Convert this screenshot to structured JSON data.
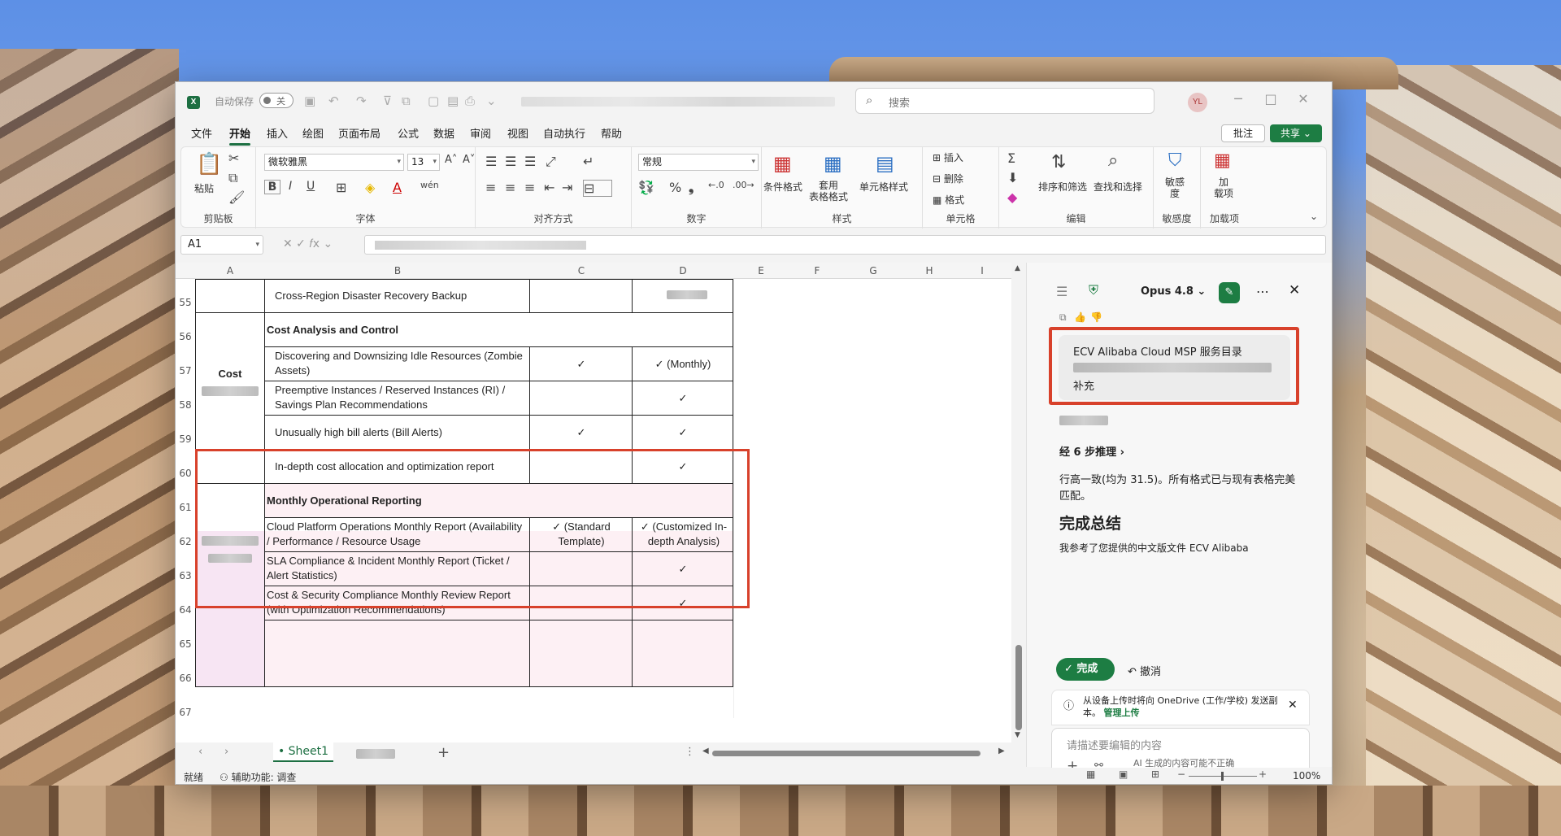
{
  "titlebar": {
    "autosave_label": "自动保存",
    "autosave_state": "关",
    "search_placeholder": "搜索",
    "user_initials": "YL"
  },
  "menu": {
    "items": [
      "文件",
      "开始",
      "插入",
      "绘图",
      "页面布局",
      "公式",
      "数据",
      "审阅",
      "视图",
      "自动执行",
      "帮助"
    ],
    "active": "开始",
    "comments_label": "批注",
    "share_label": "共享"
  },
  "ribbon": {
    "clipboard": {
      "paste": "粘贴",
      "group": "剪贴板"
    },
    "font": {
      "name": "微软雅黑",
      "size": "13",
      "group": "字体"
    },
    "alignment": {
      "group": "对齐方式"
    },
    "number": {
      "format": "常规",
      "group": "数字"
    },
    "styles": {
      "conditional": "条件格式",
      "table": "套用\n表格格式",
      "cell": "单元格样式",
      "group": "样式"
    },
    "cells": {
      "insert": "插入",
      "delete": "删除",
      "format": "格式",
      "group": "单元格"
    },
    "editing": {
      "sort": "排序和筛选",
      "find": "查找和选择",
      "group": "编辑"
    },
    "sensitivity": {
      "label": "敏感\n度",
      "group": "敏感度"
    },
    "addins": {
      "label": "加\n载项",
      "group": "加载项"
    }
  },
  "formula_bar": {
    "cell_ref": "A1"
  },
  "sheet": {
    "columns": [
      "A",
      "B",
      "C",
      "D",
      "E",
      "F",
      "G",
      "H",
      "I"
    ],
    "rows": [
      {
        "num": "55",
        "b": "Cross-Region Disaster Recovery Backup",
        "c": "",
        "d": ""
      },
      {
        "num": "56",
        "b": "Cost Analysis and Control",
        "c": "",
        "d": ""
      },
      {
        "num": "57",
        "b": "Discovering and Downsizing Idle Resources (Zombie Assets)",
        "c": "✓",
        "d": "✓ (Monthly)"
      },
      {
        "num": "58",
        "b": "Preemptive Instances / Reserved Instances (RI) / Savings Plan Recommendations",
        "c": "",
        "d": "✓"
      },
      {
        "num": "59",
        "b": "Unusually high bill alerts (Bill Alerts)",
        "c": "✓",
        "d": "✓"
      },
      {
        "num": "60",
        "b": "In-depth cost allocation and optimization report",
        "c": "",
        "d": "✓"
      },
      {
        "num": "61",
        "b": "Monthly Operational Reporting",
        "c": "",
        "d": ""
      },
      {
        "num": "62",
        "b": "Cloud Platform Operations Monthly Report (Availability / Performance / Resource Usage",
        "c": "✓ (Standard Template)",
        "d": "✓ (Customized In-depth Analysis)"
      },
      {
        "num": "63",
        "b": "SLA Compliance & Incident Monthly Report (Ticket / Alert Statistics)",
        "c": "",
        "d": "✓"
      },
      {
        "num": "64",
        "b": "Cost & Security Compliance Monthly Review Report (with Optimization Recommendations)",
        "c": "",
        "d": "✓"
      },
      {
        "num": "65",
        "b": "",
        "c": "",
        "d": ""
      },
      {
        "num": "66",
        "b": "",
        "c": "",
        "d": ""
      },
      {
        "num": "67",
        "b": "",
        "c": "",
        "d": ""
      }
    ],
    "category_cost": "Cost",
    "tab_name": "Sheet1"
  },
  "status": {
    "ready": "就绪",
    "accessibility": "辅助功能: 调查",
    "zoom": "100%"
  },
  "copilot": {
    "model": "Opus 4.8",
    "user_message_line1": "ECV Alibaba Cloud MSP 服务目录",
    "user_message_line3": "补充",
    "steps": "经 6 步推理",
    "response_text": "行高一致(均为 31.5)。所有格式已与现有表格完美匹配。",
    "summary_title": "完成总结",
    "summary_text": "我参考了您提供的中文版文件 ECV Alibaba",
    "done_label": "完成",
    "undo_label": "撤消",
    "notice_text": "从设备上传时将向 OneDrive (工作/学校) 发送副本。",
    "notice_link": "管理上传",
    "composer_placeholder": "请描述要编辑的内容",
    "disclaimer": "AI 生成的内容可能不正确"
  },
  "colors": {
    "accent": "#1d6f42",
    "highlight_frame": "#d8412b",
    "pink_fill": "#fdf0f4"
  }
}
